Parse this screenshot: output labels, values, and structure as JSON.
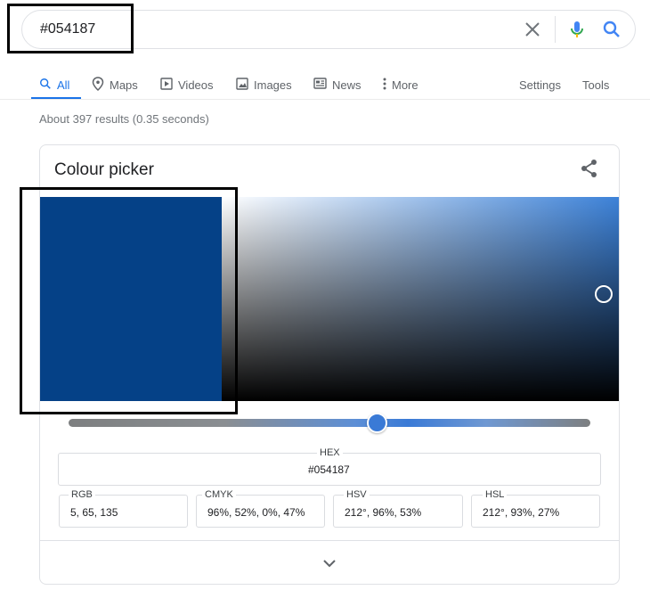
{
  "search": {
    "query": "#054187"
  },
  "tabs": [
    {
      "label": "All",
      "icon": "search-icon"
    },
    {
      "label": "Maps",
      "icon": "map-pin-icon"
    },
    {
      "label": "Videos",
      "icon": "video-icon"
    },
    {
      "label": "Images",
      "icon": "image-icon"
    },
    {
      "label": "News",
      "icon": "news-icon"
    },
    {
      "label": "More",
      "icon": "more-vert-icon"
    }
  ],
  "tools": {
    "settings": "Settings",
    "tools": "Tools"
  },
  "results_count": "About 397 results (0.35 seconds)",
  "picker": {
    "title": "Colour picker",
    "color": "#054187",
    "hex_label": "HEX",
    "hex_value": "#054187",
    "rgb_label": "RGB",
    "rgb_value": "5, 65, 135",
    "cmyk_label": "CMYK",
    "cmyk_value": "96%, 52%, 0%, 47%",
    "hsv_label": "HSV",
    "hsv_value": "212°, 96%, 53%",
    "hsl_label": "HSL",
    "hsl_value": "212°, 93%, 27%"
  },
  "colors": {
    "accent": "#1a73e8",
    "selected_swatch": "#054187"
  }
}
